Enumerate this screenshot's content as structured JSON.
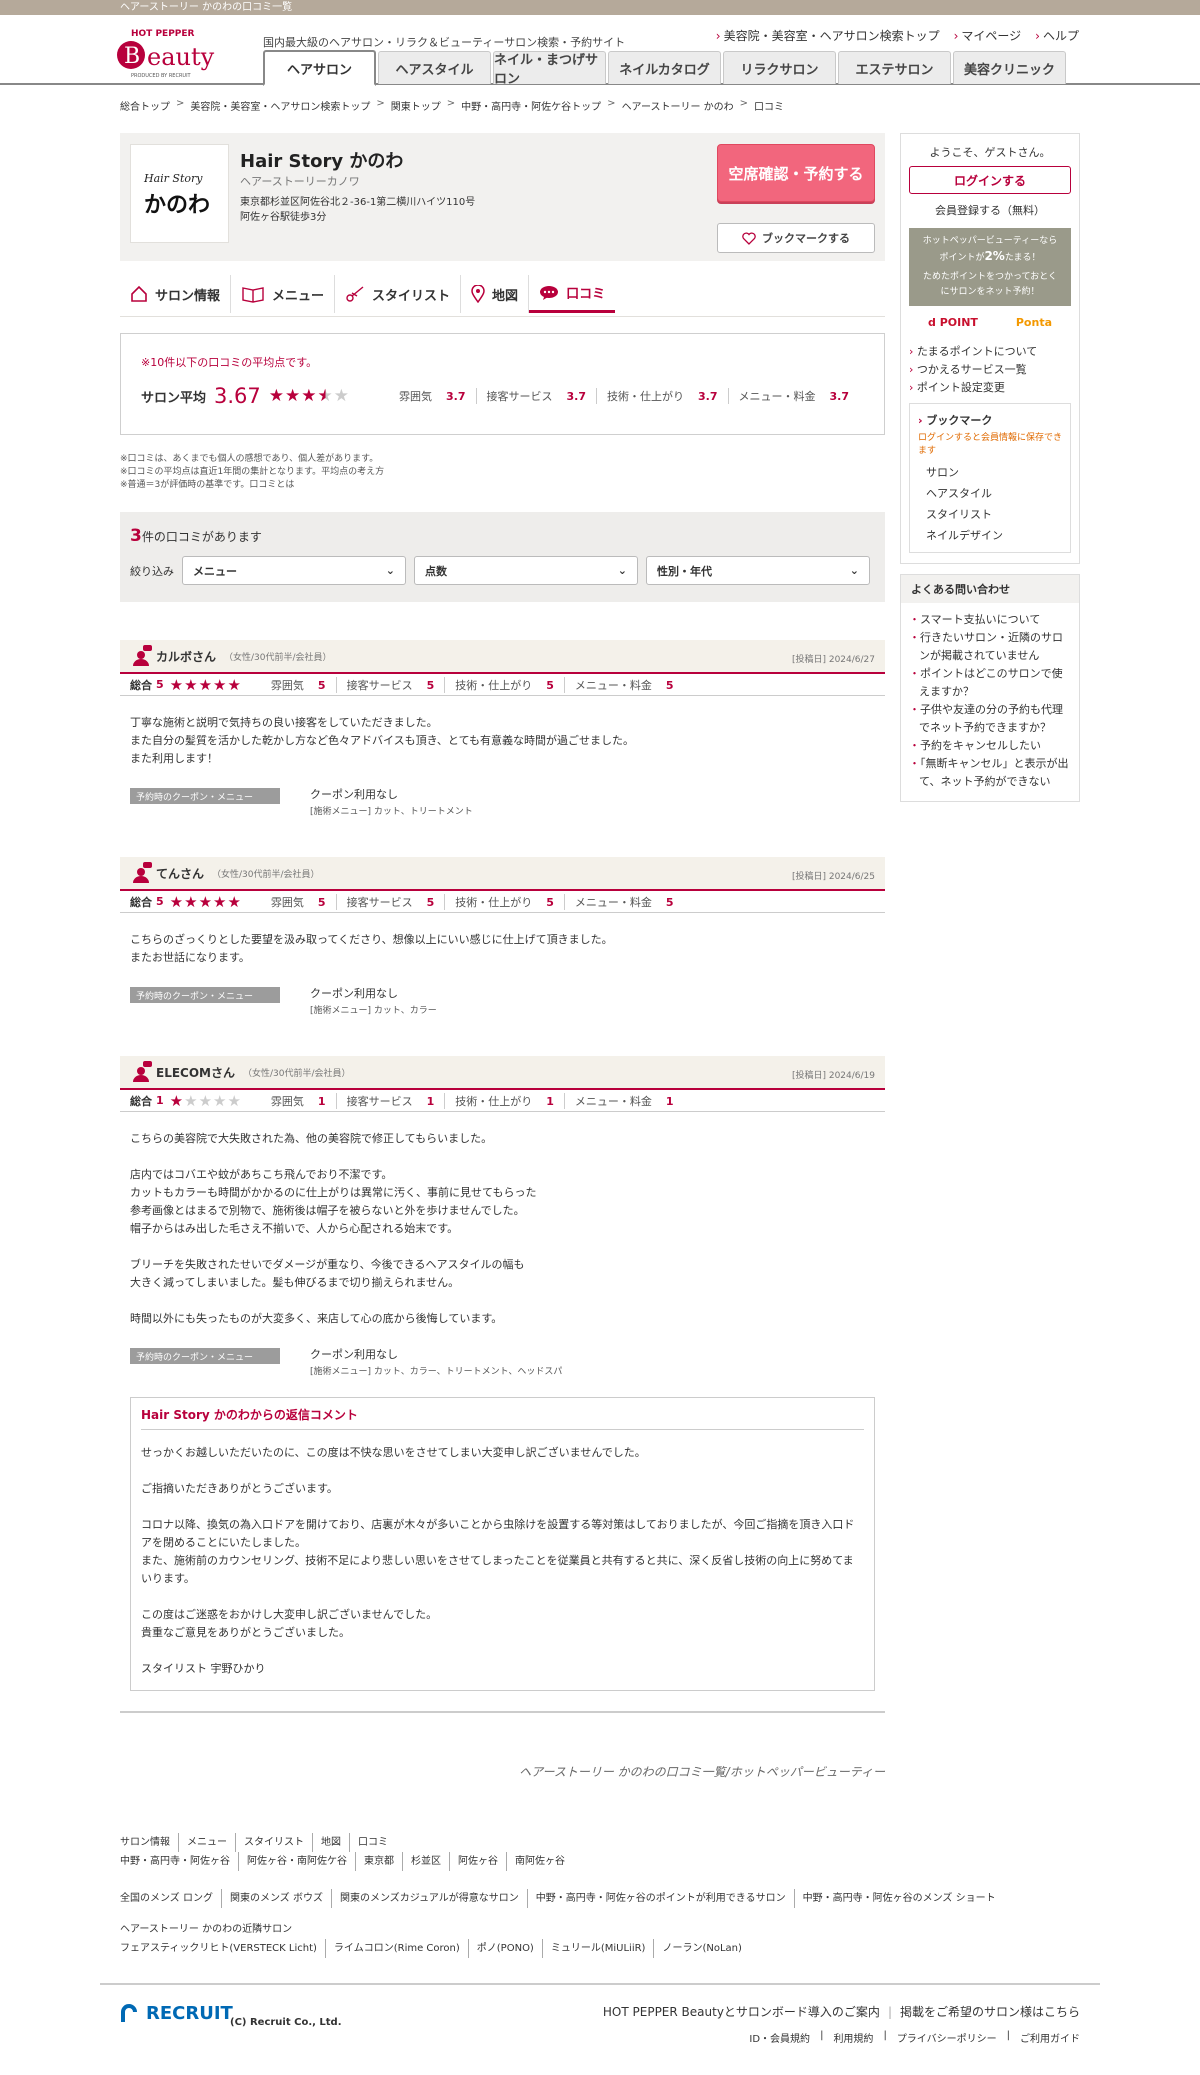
{
  "topbar": {
    "text": "ヘアーストーリー かのわの口コミ一覧"
  },
  "header": {
    "logo_top": "HOT PEPPER",
    "logo_main": "Beauty",
    "logo_sub": "PRODUCED BY RECRUIT",
    "tagline": "国内最大級のヘアサロン・リラク＆ビューティーサロン検索・予約サイト",
    "links": [
      "美容院・美容室・ヘアサロン検索トップ",
      "マイページ",
      "ヘルプ"
    ],
    "tabs": [
      "ヘアサロン",
      "ヘアスタイル",
      "ネイル・まつげサロン",
      "ネイルカタログ",
      "リラクサロン",
      "エステサロン",
      "美容クリニック"
    ]
  },
  "breadcrumb": [
    "総合トップ",
    "美容院・美容室・ヘアサロン検索トップ",
    "関東トップ",
    "中野・高円寺・阿佐ケ谷トップ",
    "ヘアーストーリー かのわ",
    "口コミ"
  ],
  "salon": {
    "logo_text": "かのわ",
    "logo_small": "Hair Story",
    "name": "Hair Story かのわ",
    "kana": "ヘアーストーリーカノワ",
    "address": "東京都杉並区阿佐谷北２-36-1第二横川ハイツ110号",
    "access": "阿佐ヶ谷駅徒歩3分",
    "reserve": "空席確認・予約する",
    "bookmark": "ブックマークする"
  },
  "subtabs": [
    "サロン情報",
    "メニュー",
    "スタイリスト",
    "地図",
    "口コミ"
  ],
  "average": {
    "note": "※10件以下の口コミの平均点です。",
    "label": "サロン平均",
    "score": "3.67",
    "rating": 3.67,
    "cats": [
      {
        "label": "雰囲気",
        "value": "3.7"
      },
      {
        "label": "接客サービス",
        "value": "3.7"
      },
      {
        "label": "技術・仕上がり",
        "value": "3.7"
      },
      {
        "label": "メニュー・料金",
        "value": "3.7"
      }
    ]
  },
  "notes": [
    "※口コミは、あくまでも個人の感想であり、個人差があります。",
    "※口コミの平均点は直近1年間の集計となります。平均点の考え方",
    "※普通＝3が評価時の基準です。口コミとは"
  ],
  "filter": {
    "count": "3",
    "title_suffix": "件の口コミがあります",
    "label": "絞り込み",
    "selects": [
      "メニュー",
      "点数",
      "性別・年代"
    ]
  },
  "score_labels": {
    "total": "総合",
    "cats": [
      "雰囲気",
      "接客サービス",
      "技術・仕上がり",
      "メニュー・料金"
    ]
  },
  "coupon_label": "予約時のクーポン・メニュー",
  "reviews": [
    {
      "name": "カルボさん",
      "attr": "（女性/30代前半/会社員）",
      "date": "[投稿日] 2024/6/27",
      "total": "5",
      "rating": 5,
      "cats": [
        "5",
        "5",
        "5",
        "5"
      ],
      "body": "丁寧な施術と説明で気持ちの良い接客をしていただきました。\nまた自分の髪質を活かした乾かし方など色々アドバイスも頂き、とても有意義な時間が過ごせました。\nまた利用します！",
      "coupon": "クーポン利用なし",
      "menu": "[施術メニュー] カット、トリートメント"
    },
    {
      "name": "てんさん",
      "attr": "（女性/30代前半/会社員）",
      "date": "[投稿日] 2024/6/25",
      "total": "5",
      "rating": 5,
      "cats": [
        "5",
        "5",
        "5",
        "5"
      ],
      "body": "こちらのざっくりとした要望を汲み取ってくださり、想像以上にいい感じに仕上げて頂きました。\nまたお世話になります。",
      "coupon": "クーポン利用なし",
      "menu": "[施術メニュー] カット、カラー"
    },
    {
      "name": "ELECOMさん",
      "attr": "（女性/30代前半/会社員）",
      "date": "[投稿日] 2024/6/19",
      "total": "1",
      "rating": 1,
      "cats": [
        "1",
        "1",
        "1",
        "1"
      ],
      "body": "こちらの美容院で大失敗された為、他の美容院で修正してもらいました。\n\n店内ではコバエや蚊があちこち飛んでおり不潔です。\nカットもカラーも時間がかかるのに仕上がりは異常に汚く、事前に見せてもらった\n参考画像とはまるで別物で、施術後は帽子を被らないと外を歩けませんでした。\n帽子からはみ出した毛さえ不揃いで、人から心配される始末です。\n\nブリーチを失敗されたせいでダメージが重なり、今後できるヘアスタイルの幅も\n大きく減ってしまいました。髪も伸びるまで切り揃えられません。\n\n時間以外にも失ったものが大変多く、来店して心の底から後悔しています。",
      "coupon": "クーポン利用なし",
      "menu": "[施術メニュー] カット、カラー、トリートメント、ヘッドスパ",
      "reply_title": "Hair Story かのわからの返信コメント",
      "reply": "せっかくお越しいただいたのに、この度は不快な思いをさせてしまい大変申し訳ございませんでした。\n\nご指摘いただきありがとうございます。\n\nコロナ以降、換気の為入口ドアを開けており、店裏が木々が多いことから虫除けを設置する等対策はしておりましたが、今回ご指摘を頂き入口ドアを閉めることにいたしました。\nまた、施術前のカウンセリング、技術不足により悲しい思いをさせてしまったことを従業員と共有すると共に、深く反省し技術の向上に努めてまいります。\n\nこの度はご迷惑をおかけし大変申し訳ございませんでした。\n貴重なご意見をありがとうございました。\n\nスタイリスト 宇野ひかり"
    }
  ],
  "page_footer": "ヘアーストーリー かのわの口コミ一覧/ホットペッパービューティー",
  "side": {
    "welcome": "ようこそ、ゲストさん。",
    "login": "ログインする",
    "register": "会員登録する（無料）",
    "point_line1": "ホットペッパービューティーなら",
    "point_line2a": "ポイントが",
    "point_pct": "2%",
    "point_line2b": "たまる！",
    "point_line3": "ためたポイントをつかっておとく",
    "point_line4": "にサロンをネット予約！",
    "logo_d": "d POINT",
    "logo_ponta": "Ponta",
    "links": [
      "たまるポイントについて",
      "つかえるサービス一覧",
      "ポイント設定変更"
    ],
    "bm_title": "ブックマーク",
    "bm_note": "ログインすると会員情報に保存できます",
    "bm_items": [
      "サロン",
      "ヘアスタイル",
      "スタイリスト",
      "ネイルデザイン"
    ],
    "faq_title": "よくある問い合わせ",
    "faq": [
      "スマート支払いについて",
      "行きたいサロン・近隣のサロンが掲載されていません",
      "ポイントはどこのサロンで使えますか？",
      "子供や友達の分の予約も代理でネット予約できますか？",
      "予約をキャンセルしたい",
      "「無断キャンセル」と表示が出て、ネット予約ができない"
    ]
  },
  "footlinks": {
    "row1": [
      "サロン情報",
      "メニュー",
      "スタイリスト",
      "地図",
      "口コミ"
    ],
    "row2": [
      "中野・高円寺・阿佐ヶ谷",
      "阿佐ヶ谷・南阿佐ケ谷",
      "東京都",
      "杉並区",
      "阿佐ヶ谷",
      "南阿佐ヶ谷"
    ],
    "row3": [
      "全国のメンズ ロング",
      "関東のメンズ ボウズ",
      "関東のメンズカジュアルが得意なサロン",
      "中野・高円寺・阿佐ヶ谷のポイントが利用できるサロン",
      "中野・高円寺・阿佐ヶ谷のメンズ ショート"
    ],
    "nearby_title": "ヘアーストーリー かのわの近隣サロン",
    "row4": [
      "フェアスティックリヒト(VERSTECK Licht)",
      "ライムコロン(Rime Coron)",
      "ポノ(PONO)",
      "ミュリール(MiULiiR)",
      "ノーラン(NoLan)"
    ]
  },
  "footer": {
    "recruit": "RECRUIT",
    "copy": "(C) Recruit Co., Ltd.",
    "right1": "HOT PEPPER Beautyとサロンボード導入のご案内",
    "right2": "掲載をご希望のサロン様はこちら",
    "small": [
      "ID・会員規約",
      "利用規約",
      "プライバシーポリシー",
      "ご利用ガイド"
    ]
  }
}
